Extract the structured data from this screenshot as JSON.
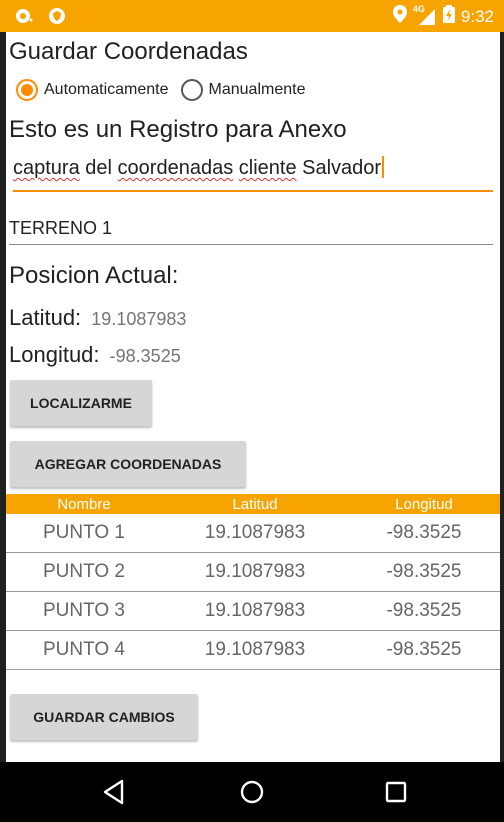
{
  "status_bar": {
    "left_icons": [
      "notification-icon",
      "shield-icon"
    ],
    "network": "4G",
    "time": "9:32",
    "background": "#f7a400"
  },
  "page_title": "Guardar Coordenadas",
  "mode": {
    "options": [
      {
        "label": "Automaticamente",
        "selected": true
      },
      {
        "label": "Manualmente",
        "selected": false
      }
    ],
    "accent": "#ff8c00"
  },
  "register_label": "Esto es un Registro para Anexo",
  "description": {
    "words": [
      "captura",
      "del",
      "coordenadas",
      "cliente",
      "Salvador"
    ],
    "misspelled": [
      true,
      false,
      true,
      true,
      false
    ]
  },
  "land_name": "TERRENO 1",
  "position": {
    "title": "Posicion Actual:",
    "lat_label": "Latitud:",
    "lat_value": "19.1087983",
    "lon_label": "Longitud:",
    "lon_value": "-98.3525"
  },
  "buttons": {
    "locate": "LOCALIZARME",
    "add": "AGREGAR COORDENADAS",
    "save": "GUARDAR CAMBIOS"
  },
  "table": {
    "headers": [
      "Nombre",
      "Latitud",
      "Longitud"
    ],
    "rows": [
      [
        "PUNTO 1",
        "19.1087983",
        "-98.3525"
      ],
      [
        "PUNTO 2",
        "19.1087983",
        "-98.3525"
      ],
      [
        "PUNTO 3",
        "19.1087983",
        "-98.3525"
      ],
      [
        "PUNTO 4",
        "19.1087983",
        "-98.3525"
      ]
    ]
  },
  "nav": [
    "back-icon",
    "home-icon",
    "recents-icon"
  ]
}
